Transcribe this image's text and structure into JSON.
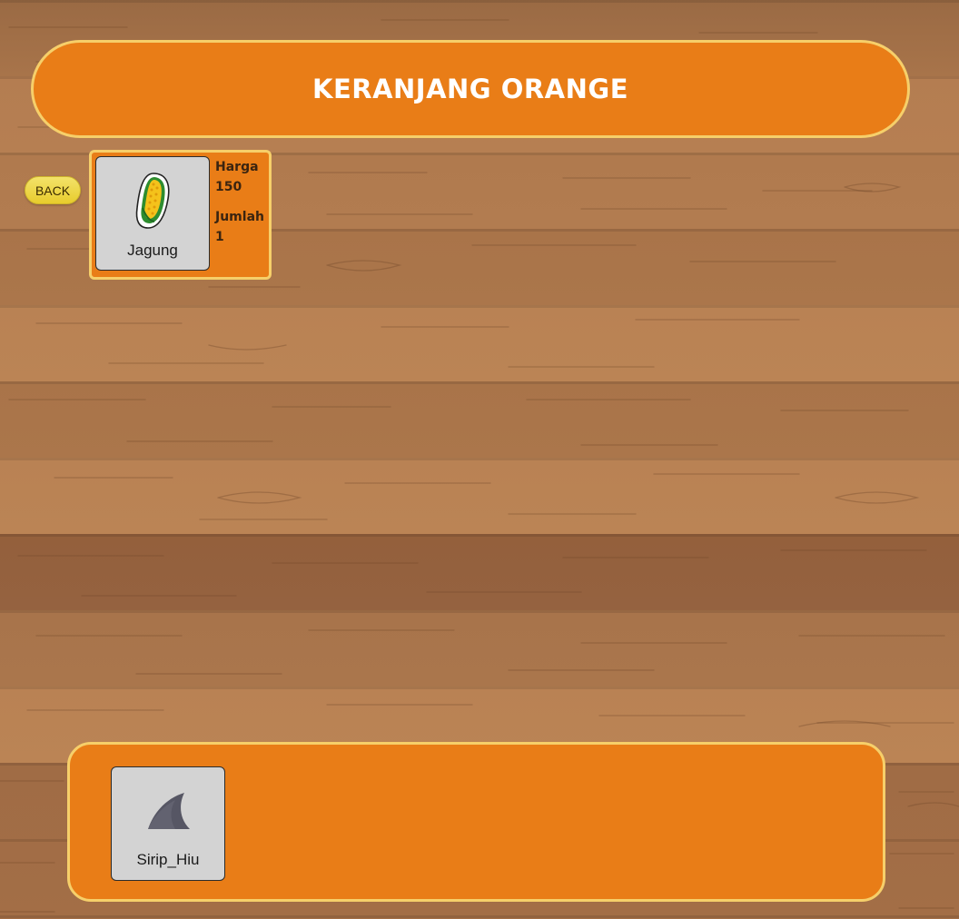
{
  "header": {
    "title": "KERANJANG ORANGE"
  },
  "nav": {
    "back_label": "BACK"
  },
  "cart": {
    "items": [
      {
        "name": "Jagung",
        "icon": "corn-icon",
        "price_label": "Harga",
        "price_value": "150",
        "qty_label": "Jumlah",
        "qty_value": "1"
      }
    ]
  },
  "inventory": {
    "items": [
      {
        "name": "Sirip_Hiu",
        "icon": "shark-fin-icon"
      }
    ]
  },
  "colors": {
    "panel_orange": "#e97d17",
    "panel_border": "#f6cf6a",
    "button_yellow": "#eedb4a",
    "tile_gray": "#d3d3d3"
  }
}
